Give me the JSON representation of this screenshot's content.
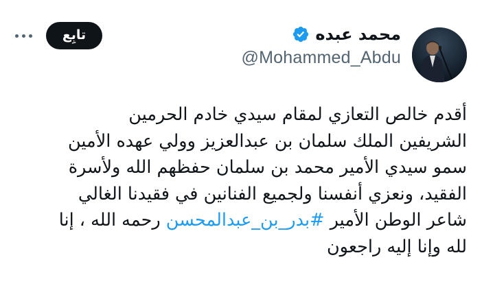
{
  "author": {
    "display_name": "محمد عبده",
    "handle": "@Mohammed_Abdu",
    "verified": true,
    "verified_color": "#1d9bf0"
  },
  "actions": {
    "follow_label": "تابِع",
    "more_icon": "ellipsis-icon"
  },
  "tweet": {
    "lines": {
      "l1": "أقدم خالص التعازي لمقام سيدي خادم الحرمين",
      "l2": "الشريفين الملك سلمان بن عبدالعزيز وولي عهده الأمين",
      "l3": "سمو سيدي الأمير محمد بن سلمان حفظهم الله ولأسرة",
      "l4": "الفقيد، ونعزي أنفسنا ولجميع الفنانين في فقيدنا الغالي",
      "l5_before": "شاعر الوطن الأمير ",
      "l5_hashtag": "#بدر_بن_عبدالمحسن",
      "l5_after": " رحمه الله ، إنا",
      "l6": "لله وإنا إليه راجعون"
    },
    "hashtag_color": "#1d9bf0",
    "text_color": "#0f1419"
  }
}
